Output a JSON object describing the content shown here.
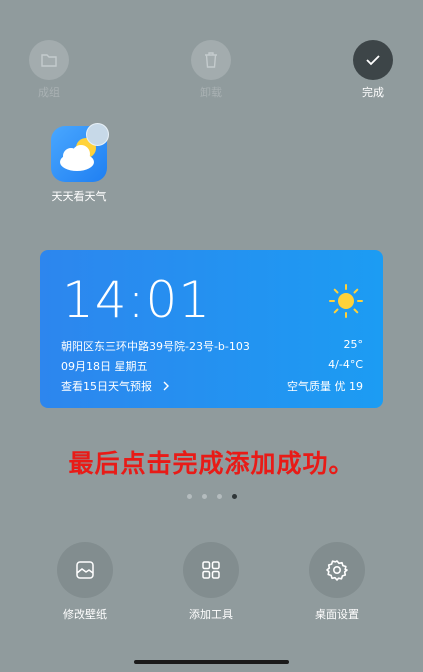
{
  "top": {
    "group_label": "成组",
    "uninstall_label": "卸载",
    "done_label": "完成"
  },
  "app": {
    "name": "天天看天气"
  },
  "widget": {
    "time": "14:01",
    "location": "朝阳区东三环中路39号院-23号-b-103",
    "temperature": "25°",
    "date": "09月18日 星期五",
    "range": "4/-4°C",
    "forecast_link": "查看15日天气预报",
    "air_quality": "空气质量 优 19"
  },
  "instruction": "最后点击完成添加成功。",
  "pager": {
    "pages": 4,
    "active": 4
  },
  "bottom": {
    "wallpaper_label": "修改壁纸",
    "tools_label": "添加工具",
    "desktop_label": "桌面设置"
  }
}
